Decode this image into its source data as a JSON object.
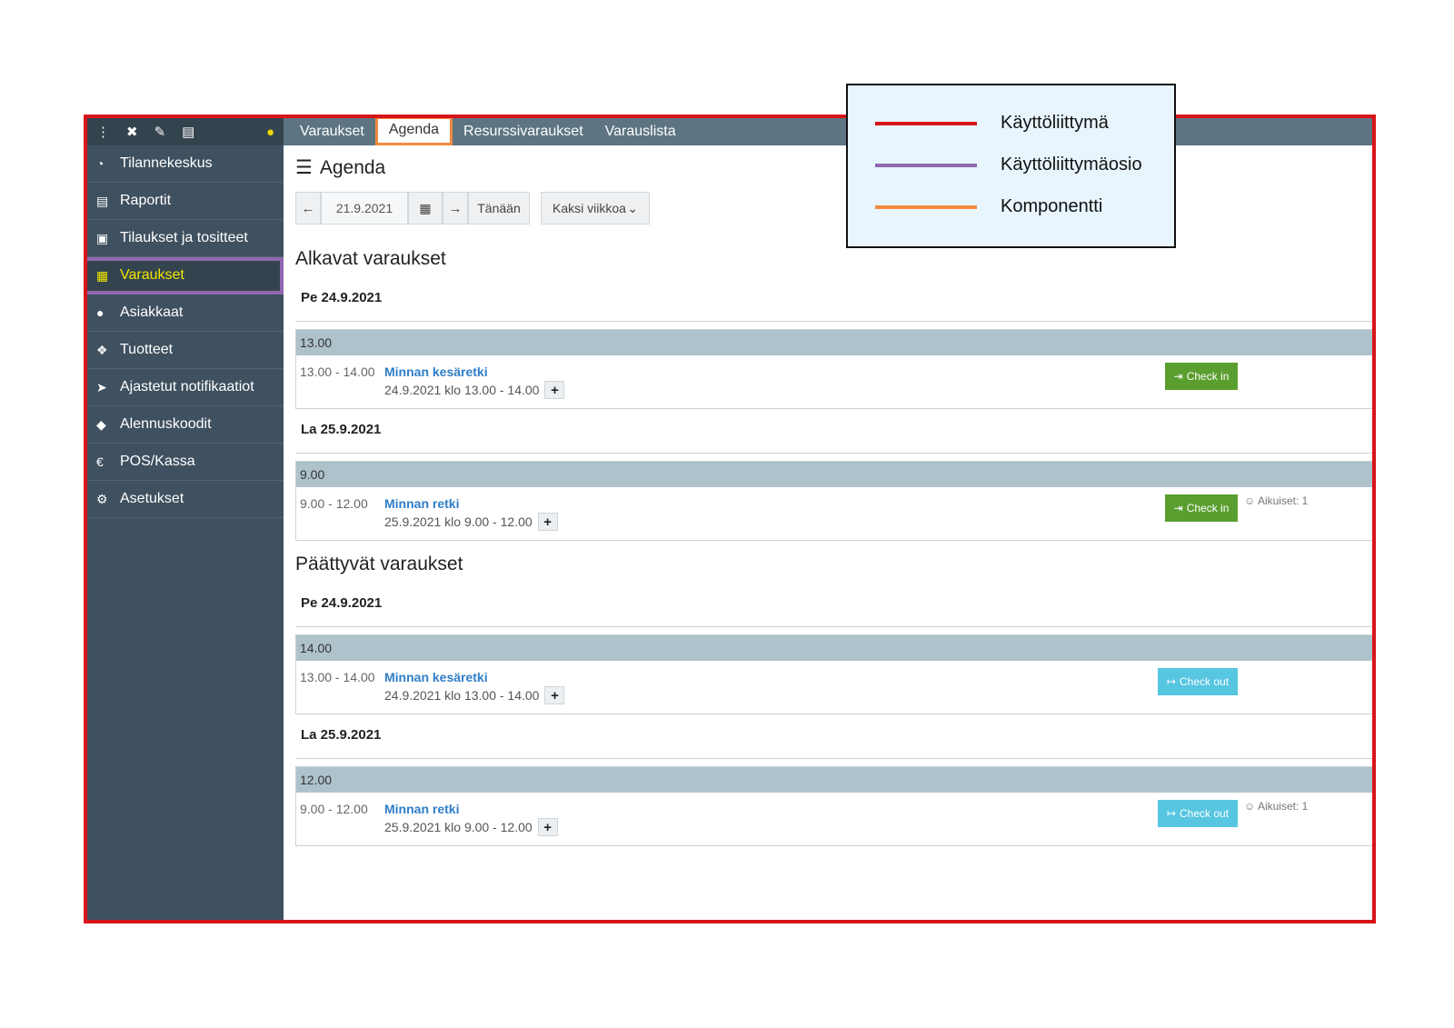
{
  "toolbar_icons": [
    "more-vertical-icon",
    "fullscreen-icon",
    "edit-icon",
    "screen-icon",
    "lock-icon"
  ],
  "sidebar": {
    "items": [
      {
        "label": "Tilannekeskus",
        "icon": "dashboard-icon",
        "glyph": "◔"
      },
      {
        "label": "Raportit",
        "icon": "book-icon",
        "glyph": "▤"
      },
      {
        "label": "Tilaukset ja tositteet",
        "icon": "cart-icon",
        "glyph": "▣"
      },
      {
        "label": "Varaukset",
        "icon": "calendar-icon",
        "glyph": "▦",
        "active": true
      },
      {
        "label": "Asiakkaat",
        "icon": "person-icon",
        "glyph": "●"
      },
      {
        "label": "Tuotteet",
        "icon": "cubes-icon",
        "glyph": "❖"
      },
      {
        "label": "Ajastetut notifikaatiot",
        "icon": "send-icon",
        "glyph": "➤"
      },
      {
        "label": "Alennuskoodit",
        "icon": "tag-icon",
        "glyph": "◆"
      },
      {
        "label": "POS/Kassa",
        "icon": "euro-icon",
        "glyph": "€"
      },
      {
        "label": "Asetukset",
        "icon": "gear-icon",
        "glyph": "⚙"
      }
    ]
  },
  "tabs": [
    {
      "label": "Varaukset"
    },
    {
      "label": "Agenda",
      "selected": true
    },
    {
      "label": "Resurssivaraukset"
    },
    {
      "label": "Varauslista"
    }
  ],
  "page": {
    "title": "Agenda",
    "date_value": "21.9.2021",
    "today_label": "Tänään",
    "range_select": "Kaksi viikkoa"
  },
  "sections": [
    {
      "title": "Alkavat varaukset",
      "days": [
        {
          "label": "Pe 24.9.2021",
          "groups": [
            {
              "time": "13.00",
              "rows": [
                {
                  "time_range": "13.00 - 14.00",
                  "name": "Minnan kesäretki",
                  "detail": "24.9.2021 klo 13.00 - 14.00",
                  "action": "Check in",
                  "adults": ""
                }
              ]
            }
          ]
        },
        {
          "label": "La 25.9.2021",
          "groups": [
            {
              "time": "9.00",
              "rows": [
                {
                  "time_range": "9.00 - 12.00",
                  "name": "Minnan retki",
                  "detail": "25.9.2021 klo 9.00 - 12.00",
                  "action": "Check in",
                  "adults": "Aikuiset: 1"
                }
              ]
            }
          ]
        }
      ]
    },
    {
      "title": "Päättyvät varaukset",
      "days": [
        {
          "label": "Pe 24.9.2021",
          "groups": [
            {
              "time": "14.00",
              "rows": [
                {
                  "time_range": "13.00 - 14.00",
                  "name": "Minnan kesäretki",
                  "detail": "24.9.2021 klo 13.00 - 14.00",
                  "action": "Check out",
                  "adults": ""
                }
              ]
            }
          ]
        },
        {
          "label": "La 25.9.2021",
          "groups": [
            {
              "time": "12.00",
              "rows": [
                {
                  "time_range": "9.00 - 12.00",
                  "name": "Minnan retki",
                  "detail": "25.9.2021 klo 9.00 - 12.00",
                  "action": "Check out",
                  "adults": "Aikuiset: 1"
                }
              ]
            }
          ]
        }
      ]
    }
  ],
  "legend": [
    {
      "label": "Käyttöliittymä",
      "color": "#d7141a"
    },
    {
      "label": "Käyttöliittymäosio",
      "color": "#9068b0"
    },
    {
      "label": "Komponentti",
      "color": "#f28a3e"
    }
  ],
  "colors": {
    "frame": "#d7141a",
    "sidebar": "#3f5060",
    "active_text": "#f2e600",
    "check_in": "#5a9e2f",
    "check_out": "#57c6e1",
    "group_header": "#aec2cc",
    "link": "#2f7dc8"
  }
}
